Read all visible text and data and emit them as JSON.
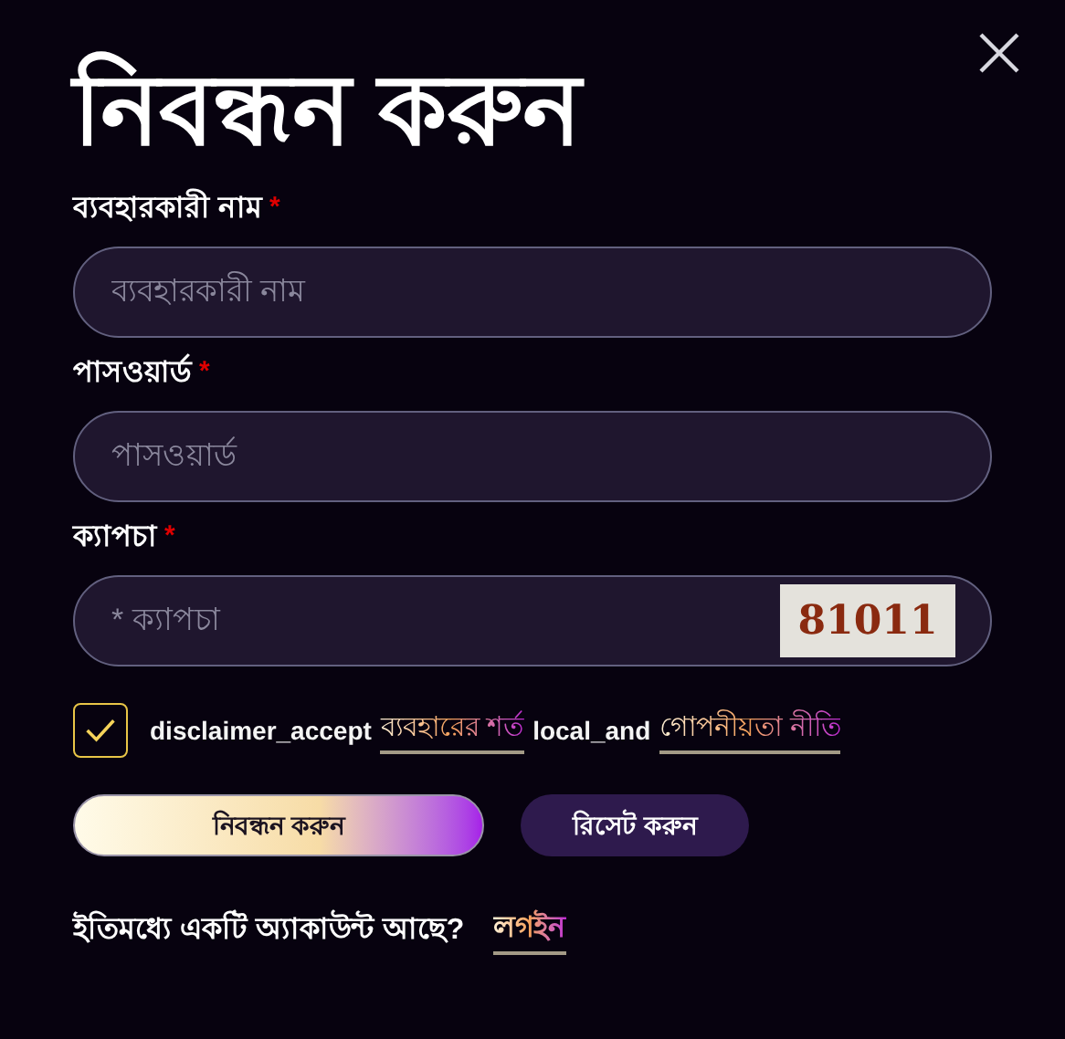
{
  "title": "নিবন্ধন করুন",
  "fields": [
    {
      "label": "ব্যবহারকারী নাম",
      "required_mark": "*",
      "placeholder": "ব্যবহারকারী নাম"
    },
    {
      "label": "পাসওয়ার্ড",
      "required_mark": "*",
      "placeholder": "পাসওয়ার্ড"
    },
    {
      "label": "ক্যাপচা",
      "required_mark": "*",
      "placeholder": "* ক্যাপচা",
      "captcha": "81011"
    }
  ],
  "agreement": {
    "checked": true,
    "parts": [
      {
        "kind": "text",
        "text": "disclaimer_accept"
      },
      {
        "kind": "link",
        "text": "ব্যবহারের শর্ত"
      },
      {
        "kind": "text",
        "text": "local_and"
      },
      {
        "kind": "link",
        "text": "গোপনীয়তা নীতি"
      }
    ]
  },
  "buttons": [
    {
      "kind": "primary",
      "label": "নিবন্ধন করুন"
    },
    {
      "kind": "secondary",
      "label": "রিসেট করুন"
    }
  ],
  "footer": {
    "text": "ইতিমধ্যে একটি অ্যাকাউন্ট আছে?",
    "link": "লগইন"
  }
}
